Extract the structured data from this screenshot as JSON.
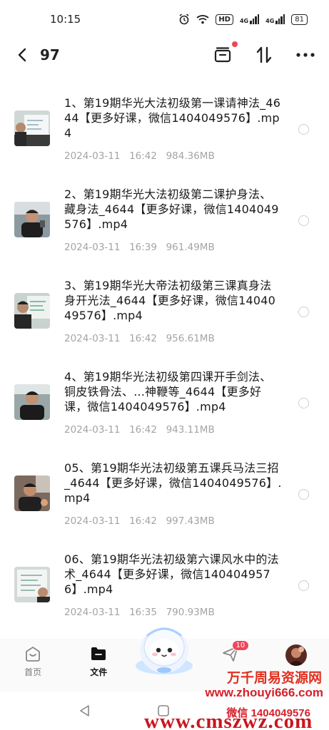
{
  "status_bar": {
    "time": "10:15",
    "hd_label": "HD",
    "signal1": "4G",
    "signal2": "4G",
    "battery": "81"
  },
  "top_bar": {
    "count": "97"
  },
  "files": [
    {
      "name": "1、第19期华光大法初级第一课请神法_4644【更多好课，微信1404049576】.mp4",
      "date": "2024-03-11",
      "time": "16:42",
      "size": "984.36MB"
    },
    {
      "name": "2、第19期华光大法初级第二课护身法、藏身法_4644【更多好课，微信1404049576】.mp4",
      "date": "2024-03-11",
      "time": "16:39",
      "size": "961.49MB"
    },
    {
      "name": "3、第19期华光大帝法初级第三课真身法身开光法_4644【更多好课，微信1404049576】.mp4",
      "date": "2024-03-11",
      "time": "16:42",
      "size": "956.61MB"
    },
    {
      "name": "4、第19期华光法初级第四课开手剑法、铜皮铁骨法、...神鞭等_4644【更多好课，微信1404049576】.mp4",
      "date": "2024-03-11",
      "time": "16:42",
      "size": "943.11MB"
    },
    {
      "name": "05、第19期华光法初级第五课兵马法三招_4644【更多好课，微信1404049576】.mp4",
      "date": "2024-03-11",
      "time": "16:42",
      "size": "997.43MB"
    },
    {
      "name": "06、第19期华光法初级第六课风水中的法术_4644【更多好课，微信1404049576】.mp4",
      "date": "2024-03-11",
      "time": "16:35",
      "size": "790.93MB"
    }
  ],
  "bottom_nav": {
    "home": "首页",
    "files": "文件",
    "share_badge": "10"
  },
  "watermark": {
    "line1": "万千周易资源网",
    "line2": "www.zhouyi666.com",
    "line3": "微信 1404049576",
    "line4": "www.cmszwz.com"
  },
  "colors": {
    "accent_red": "#f0455a",
    "meta_gray": "#a4a4a4",
    "watermark_red": "#d6202a"
  }
}
